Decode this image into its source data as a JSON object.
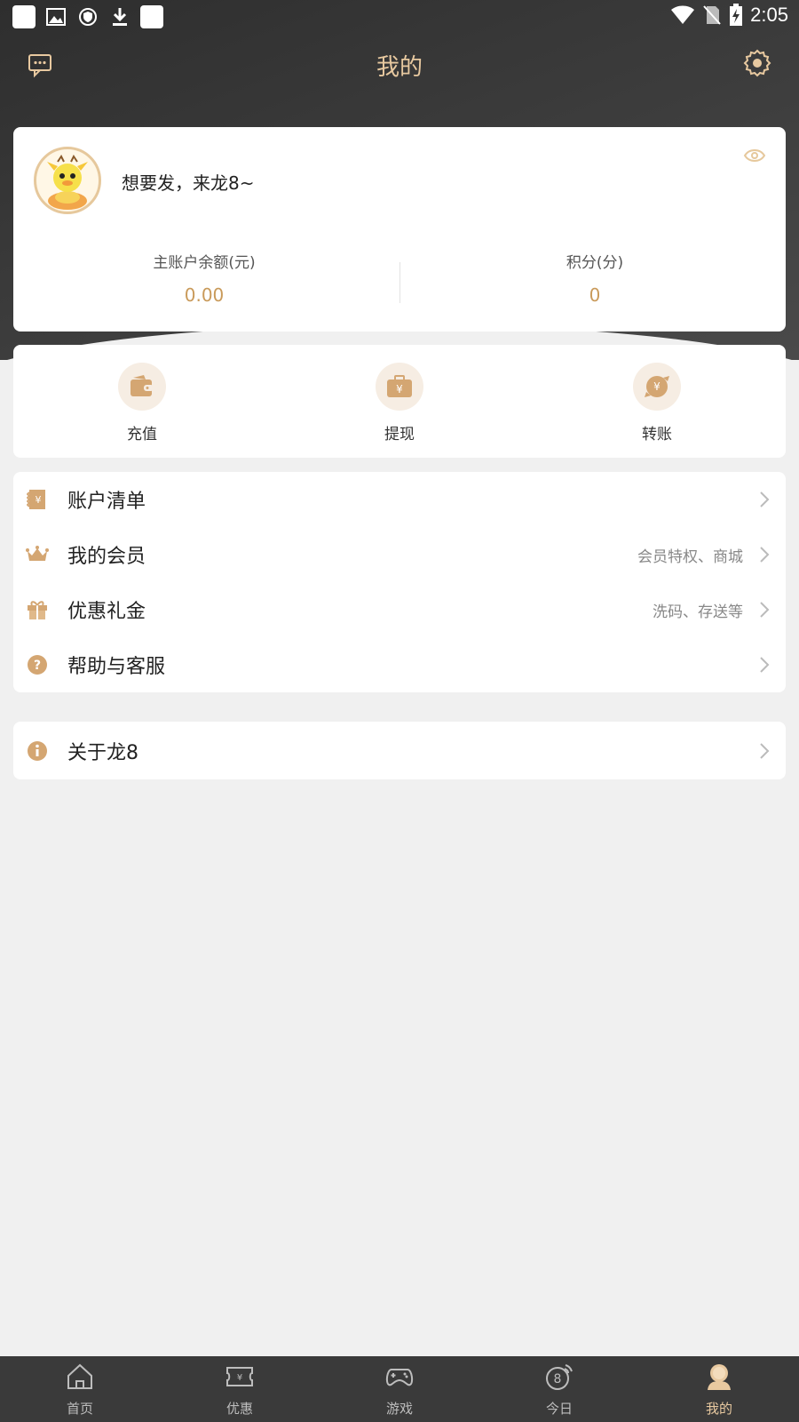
{
  "status_bar": {
    "time": "2:05"
  },
  "header": {
    "title": "我的"
  },
  "profile": {
    "username": "想要发，来龙8~",
    "balance_label": "主账户余额(元)",
    "balance_value": "0.00",
    "points_label": "积分(分)",
    "points_value": "0"
  },
  "actions": [
    {
      "label": "充值",
      "icon": "wallet-icon"
    },
    {
      "label": "提现",
      "icon": "briefcase-yen-icon"
    },
    {
      "label": "转账",
      "icon": "transfer-yen-icon"
    }
  ],
  "menu": [
    {
      "label": "账户清单",
      "hint": "",
      "icon": "bill-icon"
    },
    {
      "label": "我的会员",
      "hint": "会员特权、商城",
      "icon": "crown-icon"
    },
    {
      "label": "优惠礼金",
      "hint": "洗码、存送等",
      "icon": "gift-icon"
    },
    {
      "label": "帮助与客服",
      "hint": "",
      "icon": "help-icon"
    }
  ],
  "menu2": [
    {
      "label": "关于龙8",
      "hint": "",
      "icon": "info-icon"
    }
  ],
  "bottom_nav": [
    {
      "label": "首页",
      "icon": "home-icon"
    },
    {
      "label": "优惠",
      "icon": "ticket-icon"
    },
    {
      "label": "游戏",
      "icon": "gamepad-icon"
    },
    {
      "label": "今日",
      "icon": "today-icon"
    },
    {
      "label": "我的",
      "icon": "user-icon",
      "active": true
    }
  ],
  "colors": {
    "accent": "#c99a5a",
    "title": "#e8c9a0",
    "header_bg": "#333333",
    "nav_bg": "#3a3a3a"
  }
}
